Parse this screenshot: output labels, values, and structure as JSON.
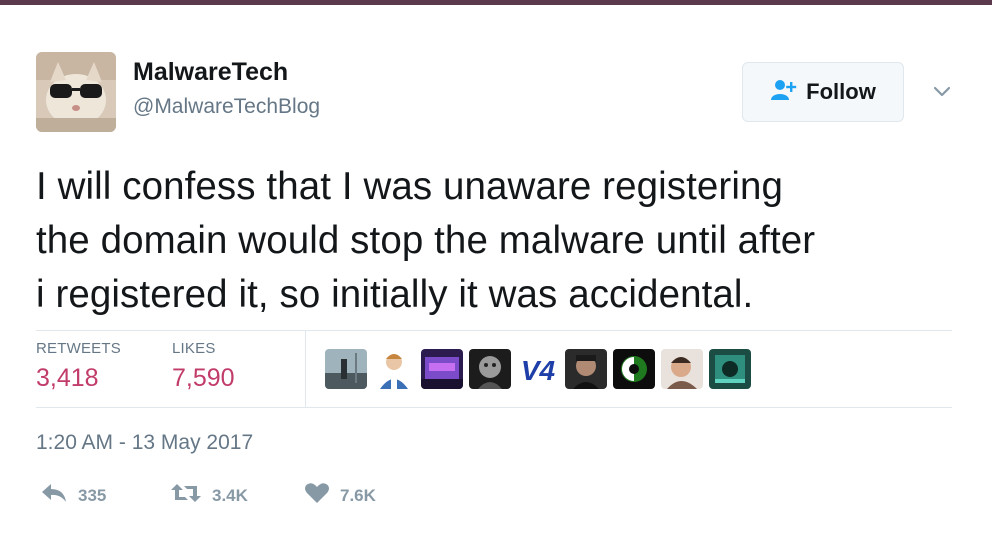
{
  "user": {
    "display_name": "MalwareTech",
    "handle": "@MalwareTechBlog"
  },
  "follow_button": {
    "label": "Follow",
    "icon": "add-user-icon"
  },
  "menu_caret": {
    "icon": "chevron-down-icon"
  },
  "tweet": {
    "lines": [
      "I will confess that I was unaware registering",
      "the domain would stop the malware until after",
      "i registered it, so initially it was accidental."
    ]
  },
  "stats": {
    "retweets_label": "RETWEETS",
    "retweets_value": "3,418",
    "likes_label": "LIKES",
    "likes_value": "7,590"
  },
  "liker_avatars": [
    {
      "name": "liker-avatar-1"
    },
    {
      "name": "liker-avatar-2"
    },
    {
      "name": "liker-avatar-3"
    },
    {
      "name": "liker-avatar-4"
    },
    {
      "name": "liker-avatar-5",
      "text": "V4"
    },
    {
      "name": "liker-avatar-6"
    },
    {
      "name": "liker-avatar-7"
    },
    {
      "name": "liker-avatar-8"
    },
    {
      "name": "liker-avatar-9"
    }
  ],
  "timestamp": "1:20 AM - 13 May 2017",
  "actions": {
    "reply_count": "335",
    "retweet_count": "3.4K",
    "like_count": "7.6K"
  },
  "colors": {
    "stat_value": "#c13c6b",
    "muted": "#657786",
    "action": "#8899a6",
    "follow_icon": "#1da1f2",
    "top_strip": "#5b3a4e"
  }
}
